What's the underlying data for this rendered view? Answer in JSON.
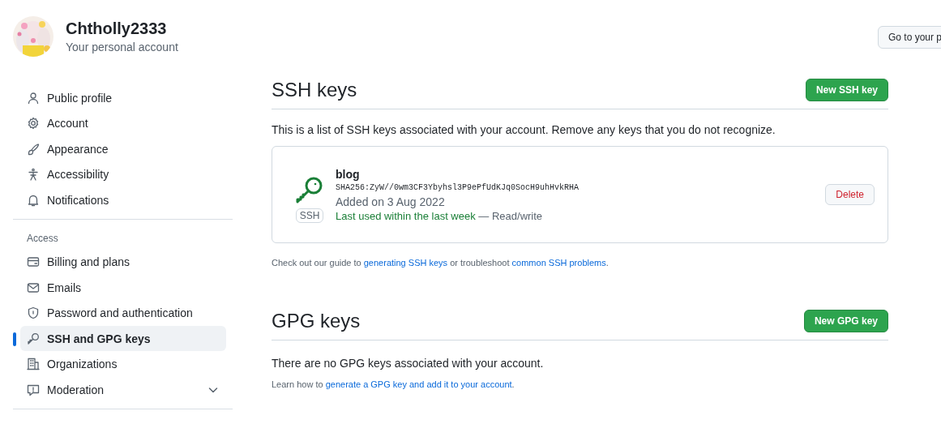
{
  "account": {
    "name": "Chtholly2333",
    "subtitle": "Your personal account"
  },
  "profile_button": "Go to your p",
  "sidebar": {
    "groups": [
      {
        "items": [
          {
            "label": "Public profile",
            "kind": "person",
            "selected": false
          },
          {
            "label": "Account",
            "kind": "gear",
            "selected": false
          },
          {
            "label": "Appearance",
            "kind": "brush",
            "selected": false
          },
          {
            "label": "Accessibility",
            "kind": "figure",
            "selected": false
          },
          {
            "label": "Notifications",
            "kind": "bell",
            "selected": false
          }
        ]
      },
      {
        "heading": "Access",
        "items": [
          {
            "label": "Billing and plans",
            "kind": "card",
            "selected": false
          },
          {
            "label": "Emails",
            "kind": "mail",
            "selected": false
          },
          {
            "label": "Password and authentication",
            "kind": "shield",
            "selected": false
          },
          {
            "label": "SSH and GPG keys",
            "kind": "key",
            "selected": true
          },
          {
            "label": "Organizations",
            "kind": "building",
            "selected": false
          },
          {
            "label": "Moderation",
            "kind": "report",
            "selected": false,
            "expanded": false
          }
        ]
      }
    ]
  },
  "ssh": {
    "title": "SSH keys",
    "button": "New SSH key",
    "intro": "This is a list of SSH keys associated with your account. Remove any keys that you do not recognize.",
    "keys": [
      {
        "name": "blog",
        "badge": "SSH",
        "fingerprint": "SHA256:ZyW//0wm3CF3Ybyhsl3P9ePfUdKJq0SocH9uhHvkRHA",
        "added": "Added on 3 Aug 2022",
        "last_used": "Last used within the last week",
        "access": "— Read/write",
        "delete": "Delete"
      }
    ],
    "guide": [
      {
        "kind": "text",
        "text": "Check out our guide to "
      },
      {
        "kind": "link",
        "text": "generating SSH keys"
      },
      {
        "kind": "text",
        "text": " or troubleshoot "
      },
      {
        "kind": "link",
        "text": "common SSH problems"
      },
      {
        "kind": "text",
        "text": "."
      }
    ]
  },
  "gpg": {
    "title": "GPG keys",
    "button": "New GPG key",
    "intro": "There are no GPG keys associated with your account.",
    "guide": [
      {
        "kind": "text",
        "text": "Learn how to "
      },
      {
        "kind": "link",
        "text": "generate a GPG key and add it to your account"
      },
      {
        "kind": "text",
        "text": "."
      }
    ]
  }
}
